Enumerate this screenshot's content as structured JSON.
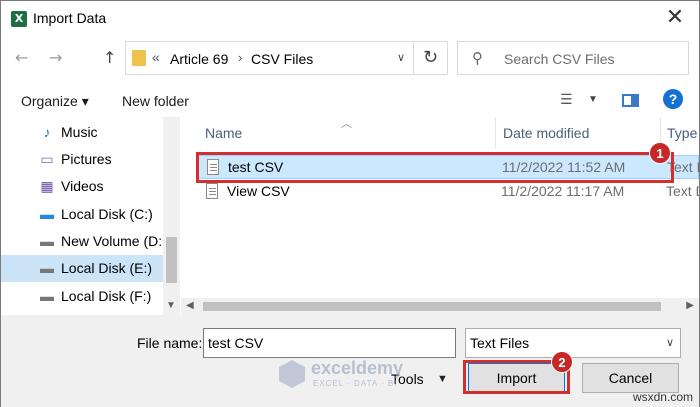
{
  "window": {
    "title": "Import Data",
    "close_glyph": "✕"
  },
  "address": {
    "back_glyph": "←",
    "forward_glyph": "→",
    "up_glyph": "↑",
    "chevron": "«",
    "segments": [
      "Article 69",
      "CSV Files"
    ],
    "separator": "›",
    "dropdown_glyph": "∨",
    "refresh_glyph": "↻"
  },
  "search": {
    "placeholder": "Search CSV Files",
    "icon": "search-icon"
  },
  "toolbar": {
    "organize_label": "Organize ▾",
    "new_folder_label": "New folder",
    "help_glyph": "?"
  },
  "nav": {
    "items": [
      {
        "label": "Music",
        "icon": "music-icon",
        "glyph": "♪",
        "selected": false
      },
      {
        "label": "Pictures",
        "icon": "pictures-icon",
        "glyph": "▭",
        "selected": false
      },
      {
        "label": "Videos",
        "icon": "videos-icon",
        "glyph": "▦",
        "selected": false
      },
      {
        "label": "Local Disk (C:)",
        "icon": "windows-drive-icon",
        "glyph": "▬",
        "selected": false
      },
      {
        "label": "New Volume (D:",
        "icon": "drive-icon",
        "glyph": "▬",
        "selected": false
      },
      {
        "label": "Local Disk (E:)",
        "icon": "drive-icon",
        "glyph": "▬",
        "selected": true
      },
      {
        "label": "Local Disk (F:)",
        "icon": "drive-icon",
        "glyph": "▬",
        "selected": false
      }
    ]
  },
  "list": {
    "columns": [
      "Name",
      "Date modified",
      "Type"
    ],
    "rows": [
      {
        "name": "test CSV",
        "date": "11/2/2022 11:52 AM",
        "type": "Text D",
        "selected": true
      },
      {
        "name": "View CSV",
        "date": "11/2/2022 11:17 AM",
        "type": "Text D",
        "selected": false
      }
    ]
  },
  "bottom": {
    "file_name_label": "File name:",
    "file_name_value": "test CSV",
    "file_type_value": "Text Files",
    "tools_label": "Tools",
    "import_label": "Import",
    "cancel_label": "Cancel"
  },
  "annotations": {
    "badge1": "1",
    "badge2": "2"
  },
  "watermark": {
    "brand": "exceldemy",
    "tagline": "EXCEL · DATA · BI"
  },
  "credit": "wsxdn.com",
  "colors": {
    "accent": "#0078d7",
    "selection": "#cce8ff",
    "annotation": "#d32f2f"
  }
}
